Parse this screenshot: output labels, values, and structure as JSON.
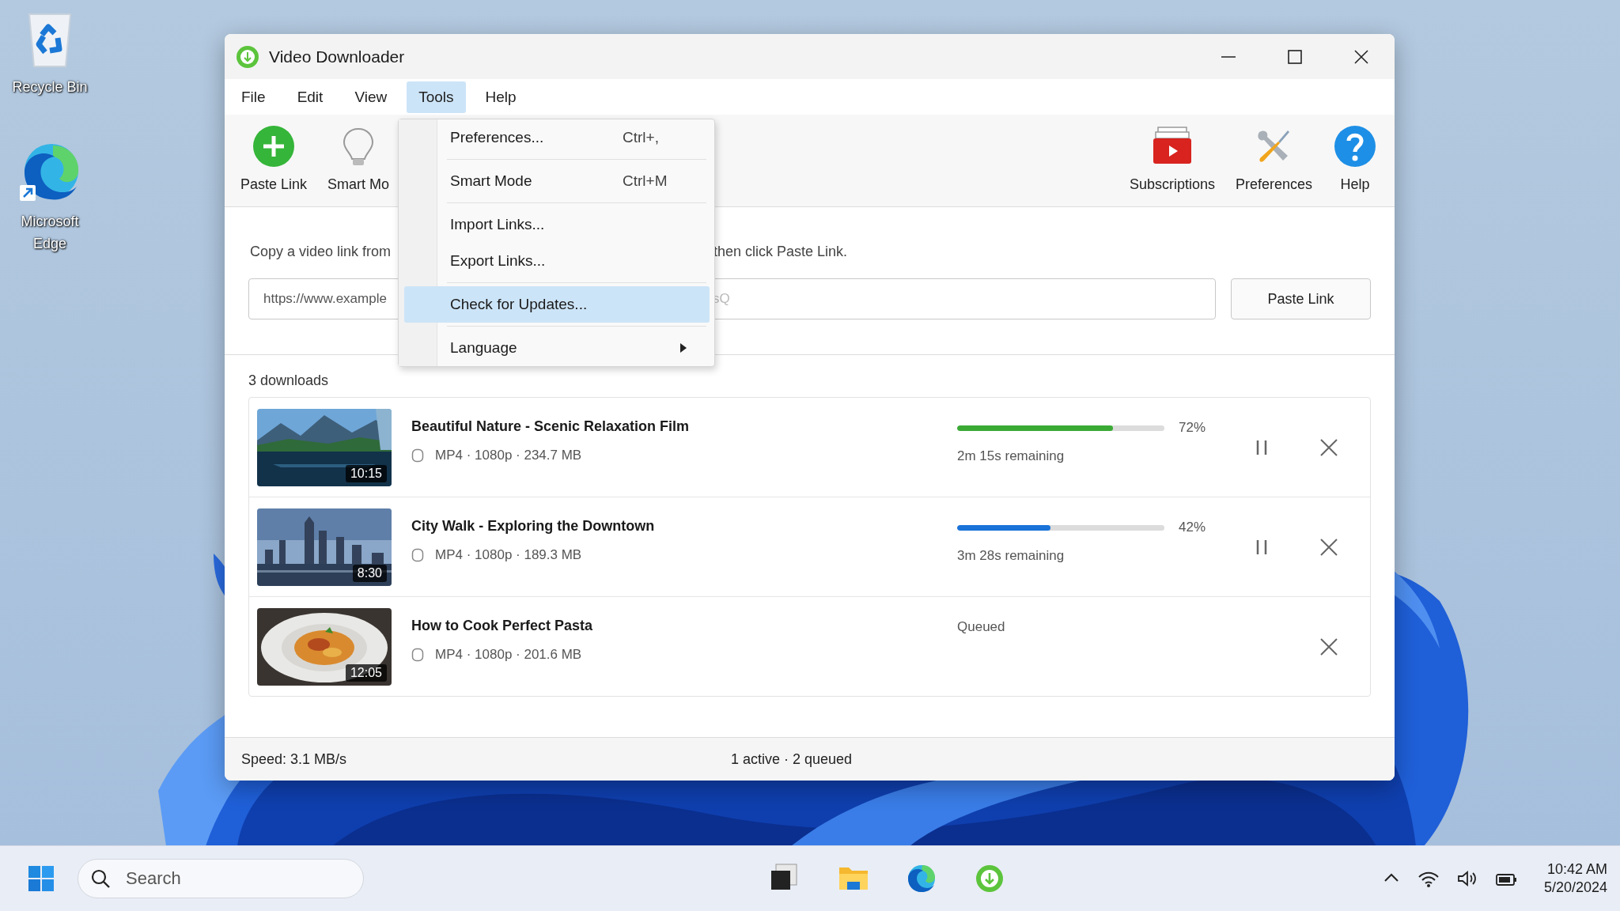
{
  "desktop_icons": [
    {
      "kind": "recycle",
      "label": "Recycle Bin"
    },
    {
      "kind": "edge",
      "label": "Microsoft Edge"
    }
  ],
  "window": {
    "title": "Video Downloader"
  },
  "menu_bar": [
    {
      "label": "File",
      "selected": false
    },
    {
      "label": "Edit",
      "selected": false
    },
    {
      "label": "View",
      "selected": false
    },
    {
      "label": "Tools",
      "selected": true
    },
    {
      "label": "Help",
      "selected": false
    }
  ],
  "tools_menu": [
    {
      "kind": "item",
      "label": "Preferences...",
      "shortcut": "Ctrl+,",
      "selected": false
    },
    {
      "kind": "separator"
    },
    {
      "kind": "item",
      "label": "Smart Mode",
      "shortcut": "Ctrl+M",
      "selected": false
    },
    {
      "kind": "separator"
    },
    {
      "kind": "item",
      "label": "Import Links...",
      "selected": false
    },
    {
      "kind": "item",
      "label": "Export Links...",
      "selected": false
    },
    {
      "kind": "separator"
    },
    {
      "kind": "item",
      "label": "Check for Updates...",
      "selected": true
    },
    {
      "kind": "separator"
    },
    {
      "kind": "submenu",
      "label": "Language",
      "selected": false
    }
  ],
  "toolbar": {
    "left": [
      {
        "kind": "add",
        "label": "Paste Link"
      },
      {
        "kind": "bulb",
        "label": "Smart Mo"
      }
    ],
    "right": [
      {
        "kind": "subscriptions",
        "label": "Subscriptions"
      },
      {
        "kind": "tools",
        "label": "Preferences"
      },
      {
        "kind": "help",
        "label": "Help"
      }
    ]
  },
  "link_section": {
    "instruction_start": "Copy a video link from",
    "instruction_end": "then click Paste Link.",
    "url_value": "https://www.example",
    "url_tail": "sQ",
    "button": "Paste Link"
  },
  "downloads_count": "3 downloads",
  "downloads": [
    {
      "kind": "downloading",
      "duration": "10:15",
      "title": "Beautiful Nature - Scenic Relaxation Film",
      "meta": "MP4 · 1080p · 234.7 MB",
      "level": 0.75,
      "color": "#3aaa35",
      "percent": "72%",
      "remaining": "2m 15s remaining"
    },
    {
      "kind": "downloading",
      "duration": "8:30",
      "title": "City Walk - Exploring the Downtown",
      "meta": "MP4 · 1080p · 189.3 MB",
      "level": 0.45,
      "color": "#1a73d9",
      "percent": "42%",
      "remaining": "3m 28s remaining"
    },
    {
      "kind": "queued",
      "duration": "12:05",
      "title": "How to Cook Perfect Pasta",
      "meta": "MP4 · 1080p · 201.6 MB",
      "status": "Queued"
    }
  ],
  "status_bar": {
    "speed": "Speed: 3.1 MB/s",
    "summary": "1 active · 2 queued"
  },
  "taskbar": {
    "search_placeholder": "Search",
    "time": "10:42 AM",
    "date": "5/20/2024"
  }
}
